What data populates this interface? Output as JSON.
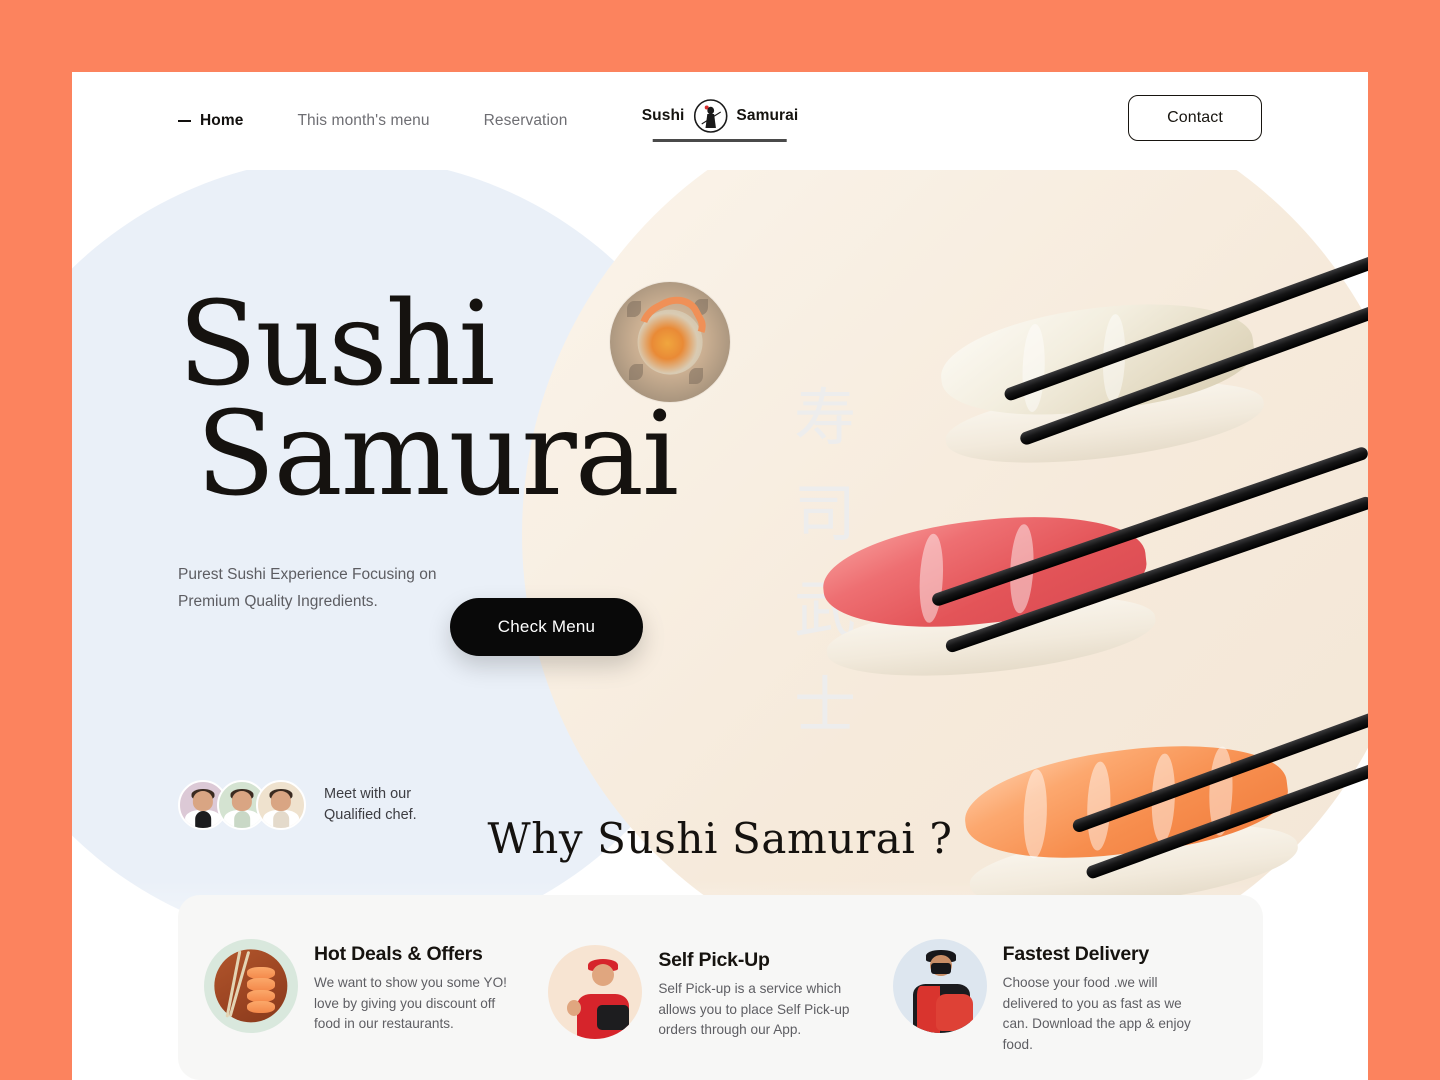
{
  "theme": {
    "frame_color": "#FC835E",
    "page_background": "#FFFFFF",
    "blue_circle": "#EAF0F8",
    "cream_circle": "#F5EDE2",
    "accent_dark": "#090909",
    "card_background": "#F7F7F6"
  },
  "header": {
    "nav": [
      {
        "label": "Home",
        "active": true
      },
      {
        "label": "This month's menu",
        "active": false
      },
      {
        "label": "Reservation",
        "active": false
      }
    ],
    "logo": {
      "word_left": "Sushi",
      "word_right": "Samurai",
      "mark": "samurai-emblem-icon"
    },
    "contact_label": "Contact"
  },
  "hero": {
    "title_line1": "Sushi",
    "title_line2": "Samurai",
    "bowl_image": "sushi-bowl-photo",
    "tagline": "Purest Sushi Experience Focusing on Premium Quality Ingredients.",
    "cta_label": "Check Menu",
    "kanji": [
      "寿",
      "司",
      "武",
      "士"
    ],
    "chefs": {
      "caption_line1": "Meet with our",
      "caption_line2": "Qualified chef.",
      "avatars": [
        {
          "name": "chef-avatar-1",
          "bg": "#DCC9D6",
          "apron": "#1C1C1E"
        },
        {
          "name": "chef-avatar-2",
          "bg": "#D4E3D1",
          "apron": "#C9D8C6"
        },
        {
          "name": "chef-avatar-3",
          "bg": "#EFE2CE",
          "apron": "#E4DACB"
        }
      ]
    },
    "sushi_pieces": [
      {
        "name": "white-fish-nigiri",
        "color": "#EFE7D3"
      },
      {
        "name": "tuna-nigiri",
        "color": "#E3545A"
      },
      {
        "name": "salmon-nigiri",
        "color": "#F78E4E"
      }
    ]
  },
  "why_section": {
    "title": "Why Sushi Samurai ?",
    "cards": [
      {
        "icon": "salmon-sushi-board-icon",
        "title": "Hot Deals & Offers",
        "description": "We want to show you some YO! love by giving you discount off food in our restaurants."
      },
      {
        "icon": "pickup-person-icon",
        "title": "Self Pick-Up",
        "description": "Self Pick-up is a service which allows you to place Self Pick-up orders through our App."
      },
      {
        "icon": "delivery-courier-icon",
        "title": "Fastest Delivery",
        "description": "Choose your food .we will delivered to you as fast as we can. Download the app & enjoy food."
      }
    ]
  }
}
